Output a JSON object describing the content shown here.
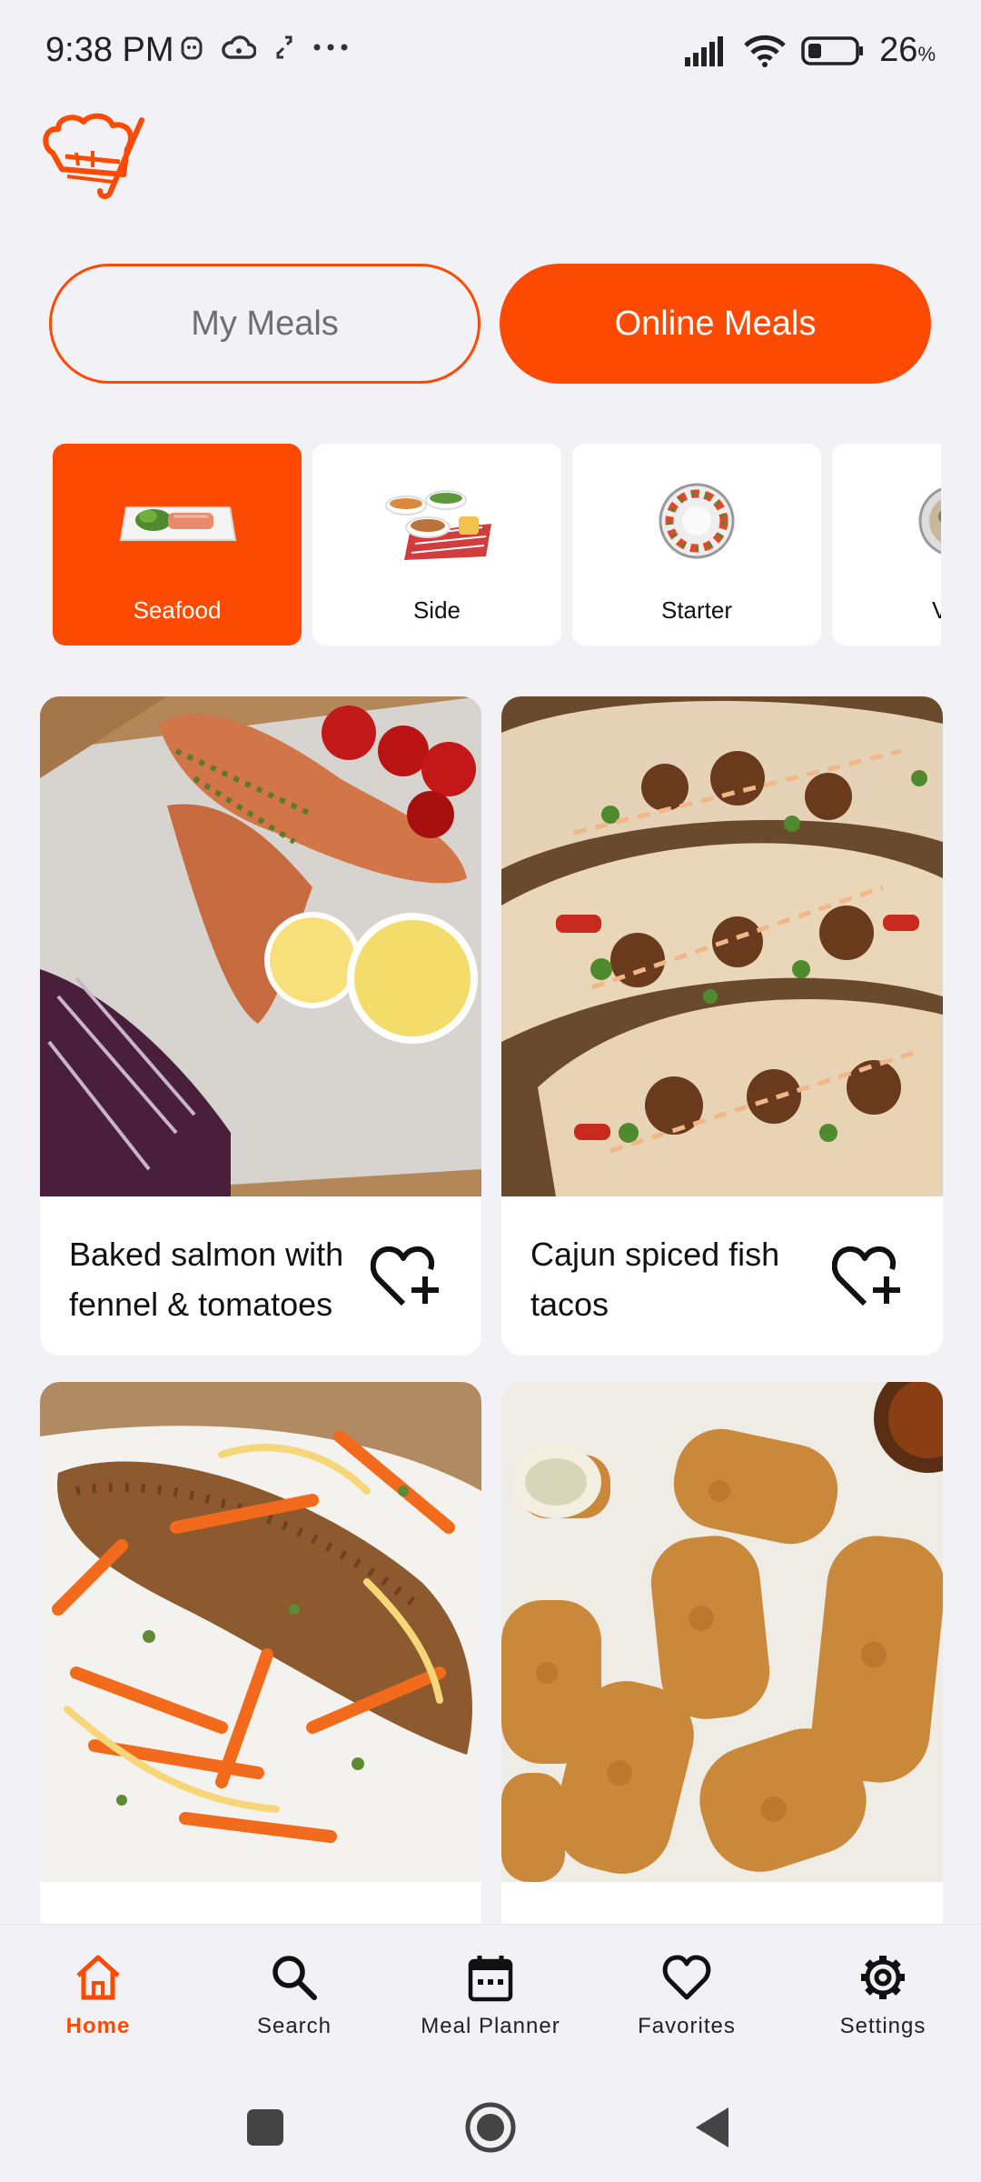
{
  "status_bar": {
    "time": "9:38 PM",
    "battery_percent": "26",
    "battery_unit": "%",
    "left_icons": [
      "face-icon",
      "cloud-icon",
      "sync-icon",
      "more-icon"
    ],
    "right_icons": [
      "signal-icon",
      "wifi-icon",
      "battery-icon"
    ]
  },
  "brand": {
    "logo_icon": "chef-hat-logo",
    "accent_color": "#fc4a03"
  },
  "toggle": {
    "my_meals_label": "My Meals",
    "online_meals_label": "Online Meals",
    "selected": "Online Meals"
  },
  "categories": [
    {
      "label": "Seafood",
      "icon": "seafood-plate-image",
      "selected": true
    },
    {
      "label": "Side",
      "icon": "side-dishes-image",
      "selected": false
    },
    {
      "label": "Starter",
      "icon": "starter-plate-image",
      "selected": false
    },
    {
      "label": "Ve",
      "icon": "vegan-bowl-image",
      "selected": false
    }
  ],
  "meals": [
    {
      "title": "Baked salmon with fennel & tomatoes",
      "photo": "baked-salmon-photo"
    },
    {
      "title": "Cajun spiced fish tacos",
      "photo": "fish-tacos-photo"
    },
    {
      "title": "",
      "photo": "fried-fish-carrots-photo"
    },
    {
      "title": "",
      "photo": "croquettes-photo"
    }
  ],
  "bottom_nav": [
    {
      "label": "Home",
      "icon": "home-icon",
      "active": true
    },
    {
      "label": "Search",
      "icon": "search-icon",
      "active": false
    },
    {
      "label": "Meal Planner",
      "icon": "calendar-icon",
      "active": false
    },
    {
      "label": "Favorites",
      "icon": "heart-icon",
      "active": false
    },
    {
      "label": "Settings",
      "icon": "gear-icon",
      "active": false
    }
  ],
  "system_nav": [
    "recents-button",
    "home-button",
    "back-button"
  ]
}
